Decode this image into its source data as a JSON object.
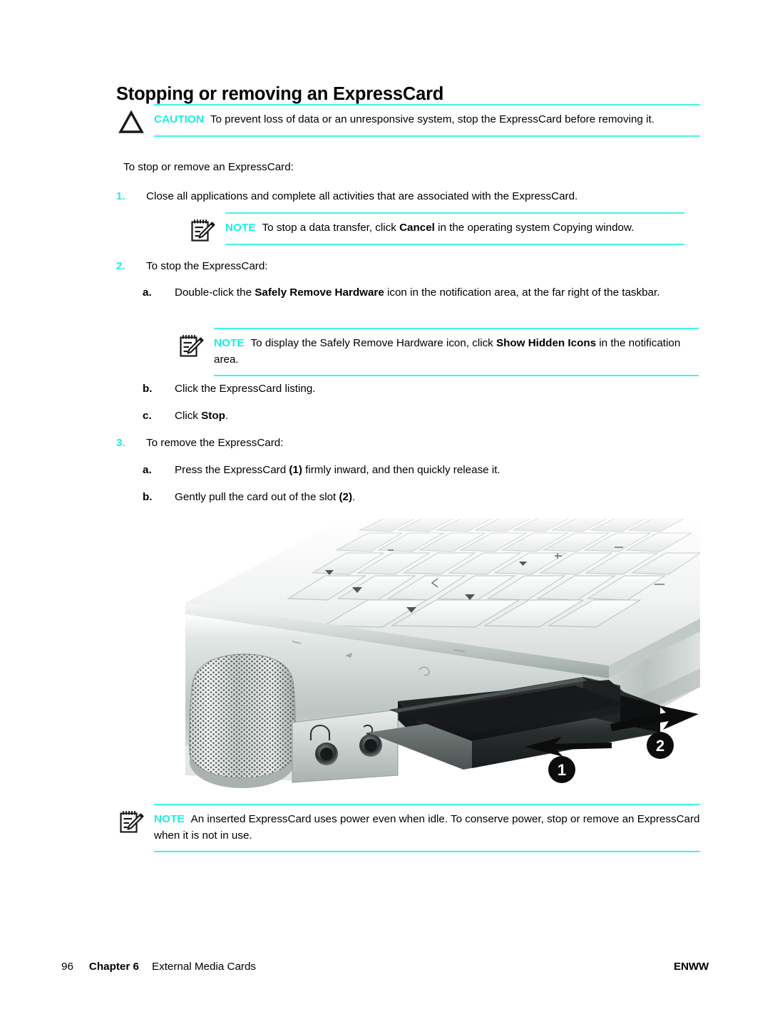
{
  "document": {
    "title": "Stopping or removing an ExpressCard"
  },
  "caution": {
    "icon": "caution-triangle-icon",
    "label": "CAUTION",
    "text_before_bold": "To prevent loss of data or an unresponsive system, stop the ExpressCard before removing it.",
    "text": "To prevent loss of data or an unresponsive system, stop the ExpressCard before removing it."
  },
  "intro": {
    "text": "To stop or remove an ExpressCard:"
  },
  "steps": [
    {
      "marker": "1.",
      "marker_type": "number",
      "text": "Close all applications and complete all activities that are associated with the ExpressCard."
    },
    {
      "marker": "2.",
      "marker_type": "number",
      "text": "To stop the ExpressCard:"
    },
    {
      "marker": "3.",
      "marker_type": "number",
      "text": "To remove the ExpressCard:"
    }
  ],
  "substeps_2": [
    {
      "marker": "a.",
      "marker_type": "alpha",
      "text_1": "Double-click the ",
      "bold_1": "Safely Remove Hardware",
      "text_2": " icon in the notification area, at the far right of the taskbar."
    },
    {
      "marker": "b.",
      "marker_type": "alpha",
      "text_1": "Click the ExpressCard listing.",
      "bold_1": "",
      "text_2": ""
    },
    {
      "marker": "c.",
      "marker_type": "alpha",
      "text_1": "Click ",
      "bold_1": "Stop",
      "text_2": "."
    }
  ],
  "substeps_3": [
    {
      "marker": "a.",
      "marker_type": "alpha",
      "text_1": "Press the ExpressCard ",
      "bold_1": "(1)",
      "text_2": " firmly inward, and then quickly release it."
    },
    {
      "marker": "b.",
      "marker_type": "alpha",
      "text_1": "Gently pull the card out of the slot ",
      "bold_1": "(2)",
      "text_2": "."
    }
  ],
  "note_1": {
    "icon": "note-notepad-pencil-icon",
    "label": "NOTE",
    "text_1": "To stop a data transfer, click ",
    "bold_1": "Cancel",
    "text_2": " in the operating system Copying window."
  },
  "note_2": {
    "icon": "note-notepad-pencil-icon",
    "label": "NOTE",
    "text_1": "To display the Safely Remove Hardware icon, click ",
    "bold_1": "Show Hidden Icons",
    "text_2": " in the notification area."
  },
  "note_3": {
    "icon": "note-notepad-pencil-icon",
    "label": "NOTE",
    "text_1": "An inserted ExpressCard uses power even when idle. To conserve power, stop or remove an ExpressCard when it is not in use.",
    "bold_1": "",
    "text_2": ""
  },
  "figure": {
    "alt": "Laptop with ExpressCard partially ejected from the slot",
    "callout_1": "1",
    "callout_2": "2"
  },
  "footer": {
    "page_number": "96",
    "chapter": "Chapter 6",
    "chapter_title": "External Media Cards",
    "right_label": "ENWW"
  },
  "colors": {
    "accent_cyan": "#17f0dd",
    "rule_cyan": "#43f5e4",
    "text_black": "#000000"
  }
}
